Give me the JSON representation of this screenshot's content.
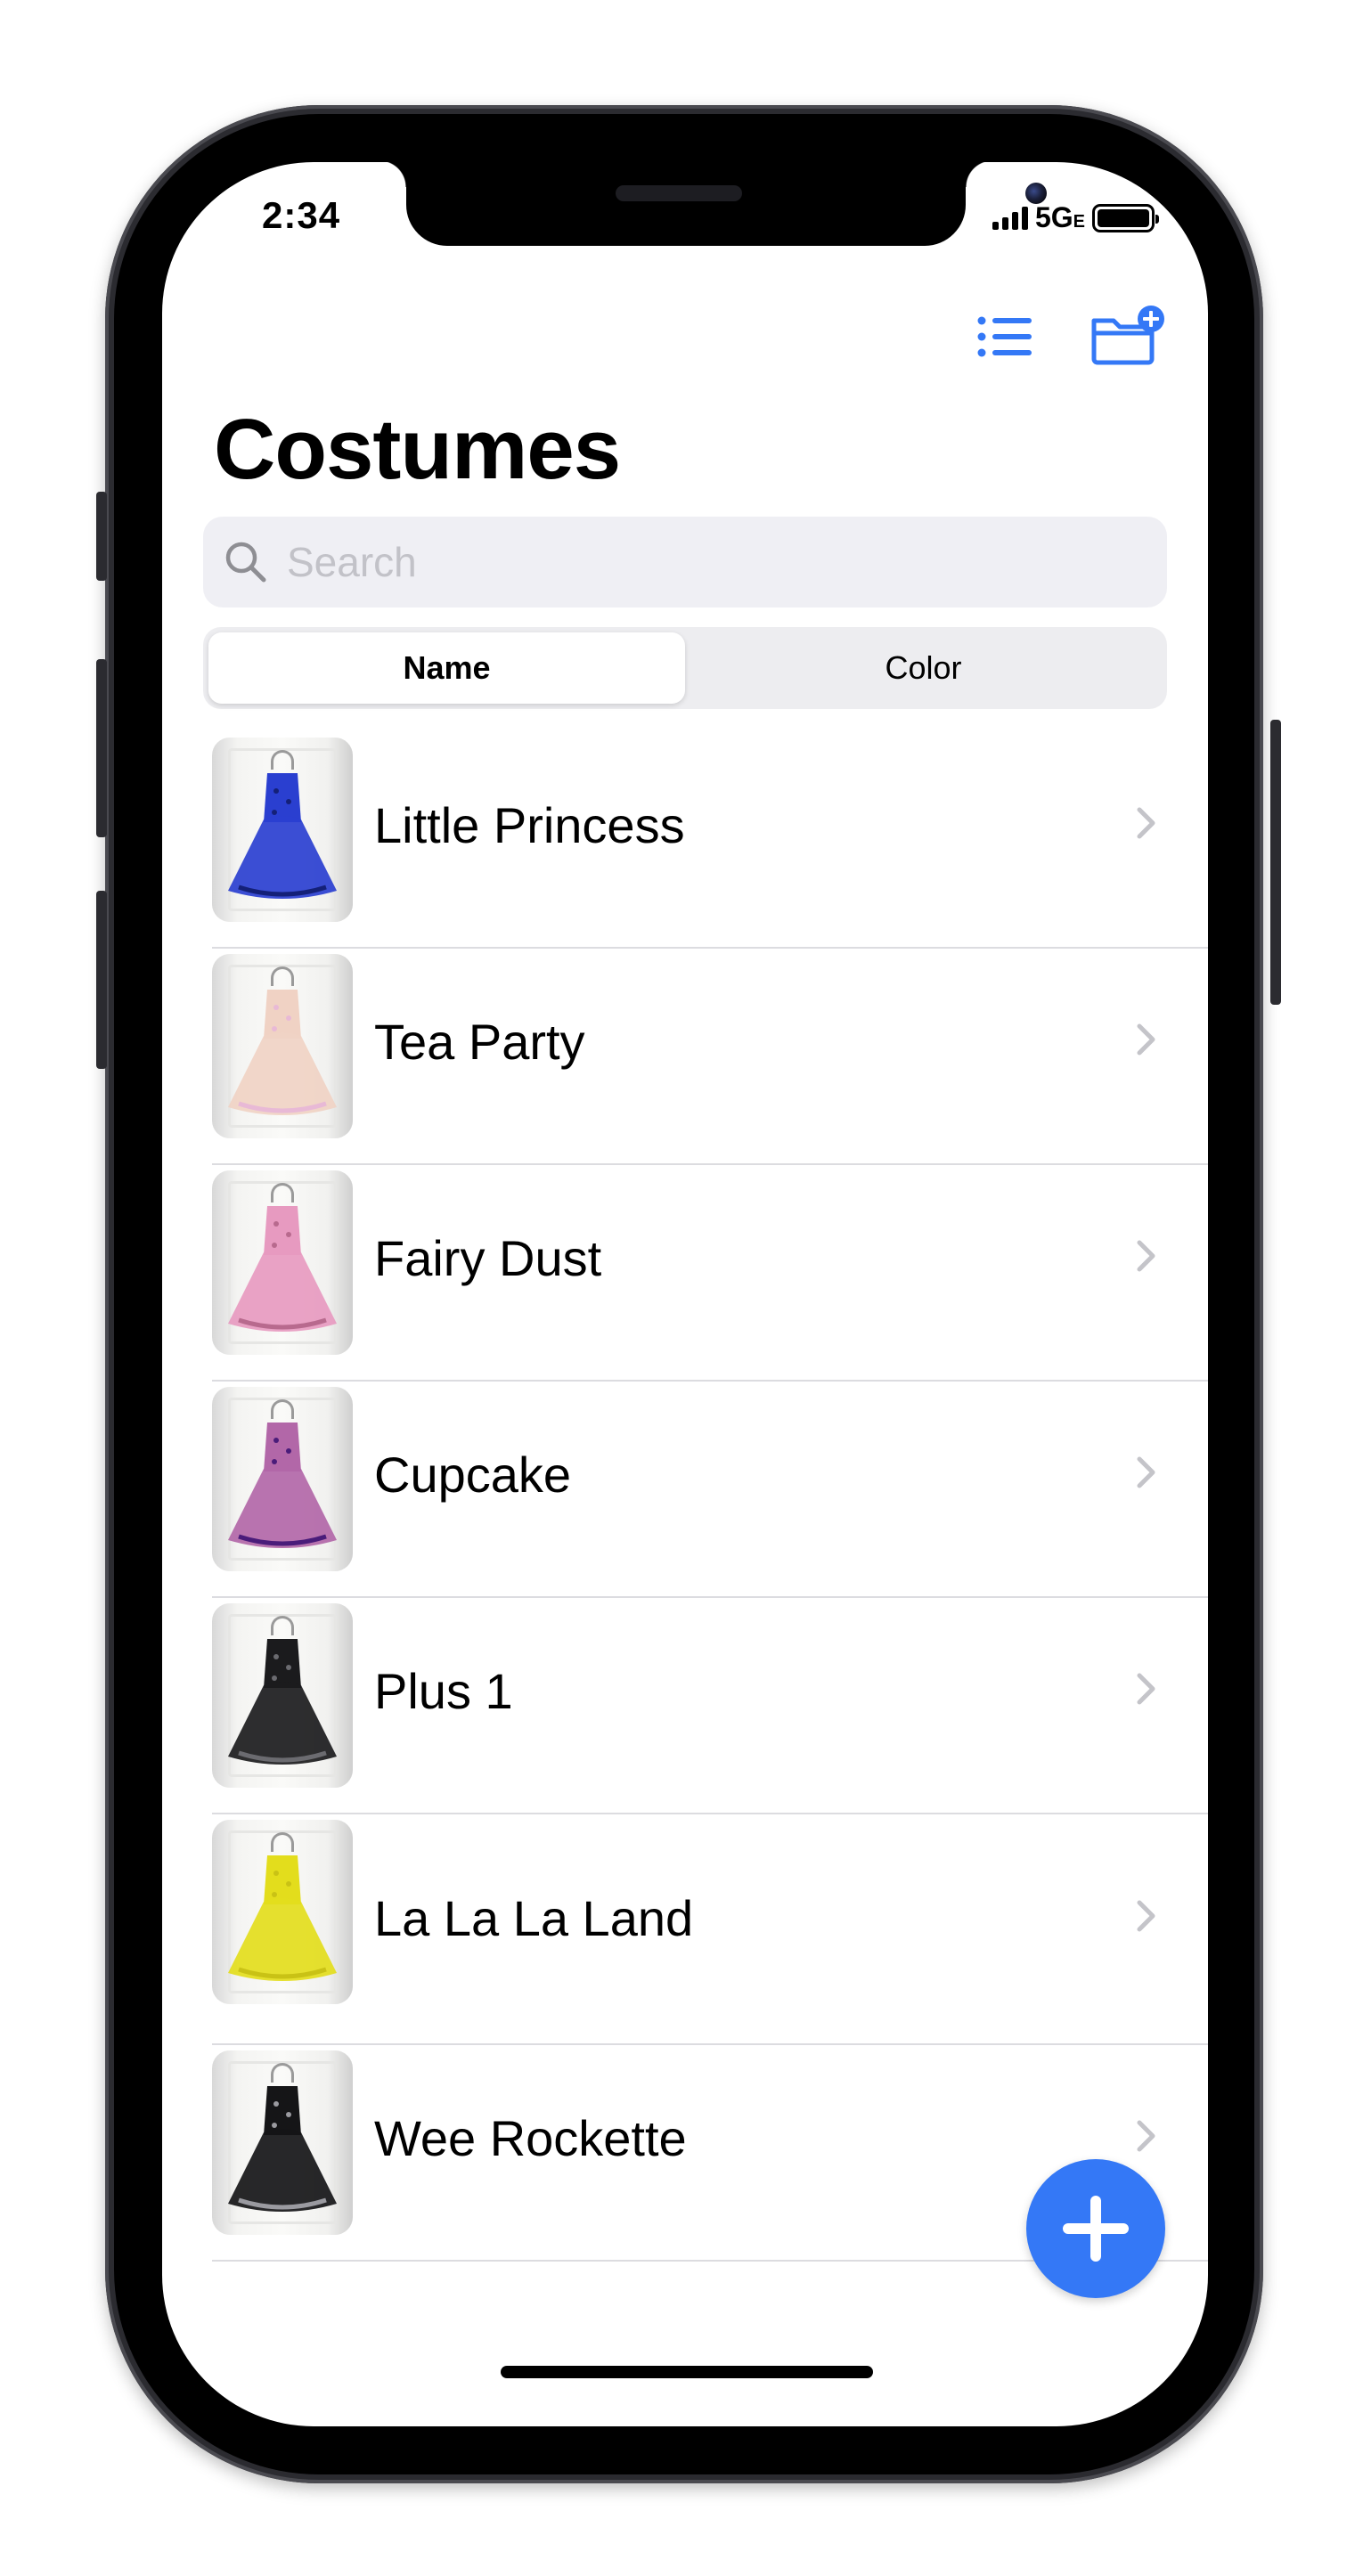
{
  "status_bar": {
    "time": "2:34",
    "network": "5G",
    "network_suffix": "E"
  },
  "nav": {
    "list_icon": "list-bullet-icon",
    "add_folder_icon": "folder-add-icon"
  },
  "page": {
    "title": "Costumes"
  },
  "search": {
    "placeholder": "Search",
    "value": ""
  },
  "segmented_control": {
    "options": [
      "Name",
      "Color"
    ],
    "selected": "Name"
  },
  "costumes": [
    {
      "name": "Little Princess",
      "dress_color": "#2a3fd0",
      "accent_color": "#142078"
    },
    {
      "name": "Tea Party",
      "dress_color": "#f0d2c4",
      "accent_color": "#e8b9d6"
    },
    {
      "name": "Fairy Dust",
      "dress_color": "#e79ac0",
      "accent_color": "#b86a8e"
    },
    {
      "name": "Cupcake",
      "dress_color": "#b267a8",
      "accent_color": "#4a1c7a"
    },
    {
      "name": "Plus 1",
      "dress_color": "#1b1b1d",
      "accent_color": "#6b6b70"
    },
    {
      "name": "La La La Land",
      "dress_color": "#e3dd1c",
      "accent_color": "#c9c215"
    },
    {
      "name": "Wee Rockette",
      "dress_color": "#151517",
      "accent_color": "#9a9aa0"
    }
  ],
  "fab": {
    "icon": "plus-icon"
  },
  "colors": {
    "accent": "#3478f6",
    "separator": "#dcdce0",
    "search_bg": "#efeff4"
  }
}
